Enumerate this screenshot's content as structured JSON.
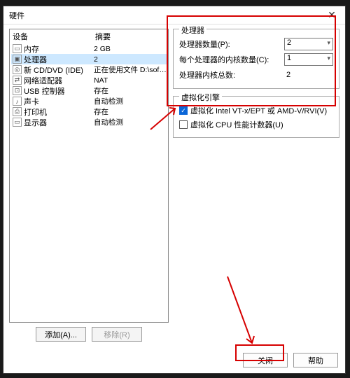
{
  "title": "硬件",
  "columns": {
    "device": "设备",
    "summary": "摘要"
  },
  "devices": [
    {
      "icon": "▭",
      "name": "内存",
      "summary": "2 GB",
      "selected": false
    },
    {
      "icon": "▣",
      "name": "处理器",
      "summary": "2",
      "selected": true
    },
    {
      "icon": "◎",
      "name": "新 CD/DVD (IDE)",
      "summary": "正在使用文件 D:\\software\\Cent...",
      "selected": false
    },
    {
      "icon": "⇄",
      "name": "网络适配器",
      "summary": "NAT",
      "selected": false
    },
    {
      "icon": "⊡",
      "name": "USB 控制器",
      "summary": "存在",
      "selected": false
    },
    {
      "icon": "♪",
      "name": "声卡",
      "summary": "自动检测",
      "selected": false
    },
    {
      "icon": "⎙",
      "name": "打印机",
      "summary": "存在",
      "selected": false
    },
    {
      "icon": "▭",
      "name": "显示器",
      "summary": "自动检测",
      "selected": false
    }
  ],
  "buttons": {
    "add": "添加(A)...",
    "remove": "移除(R)",
    "close": "关闭",
    "help": "帮助"
  },
  "proc_group": {
    "legend": "处理器",
    "num_proc_label": "处理器数量(P):",
    "num_proc_value": "2",
    "cores_label": "每个处理器的内核数量(C):",
    "cores_value": "1",
    "total_label": "处理器内核总数:",
    "total_value": "2"
  },
  "virt_group": {
    "legend": "虚拟化引擎",
    "vt_label": "虚拟化 Intel VT-x/EPT 或 AMD-V/RVI(V)",
    "vt_checked": true,
    "cpu_label": "虚拟化 CPU 性能计数器(U)",
    "cpu_checked": false
  }
}
